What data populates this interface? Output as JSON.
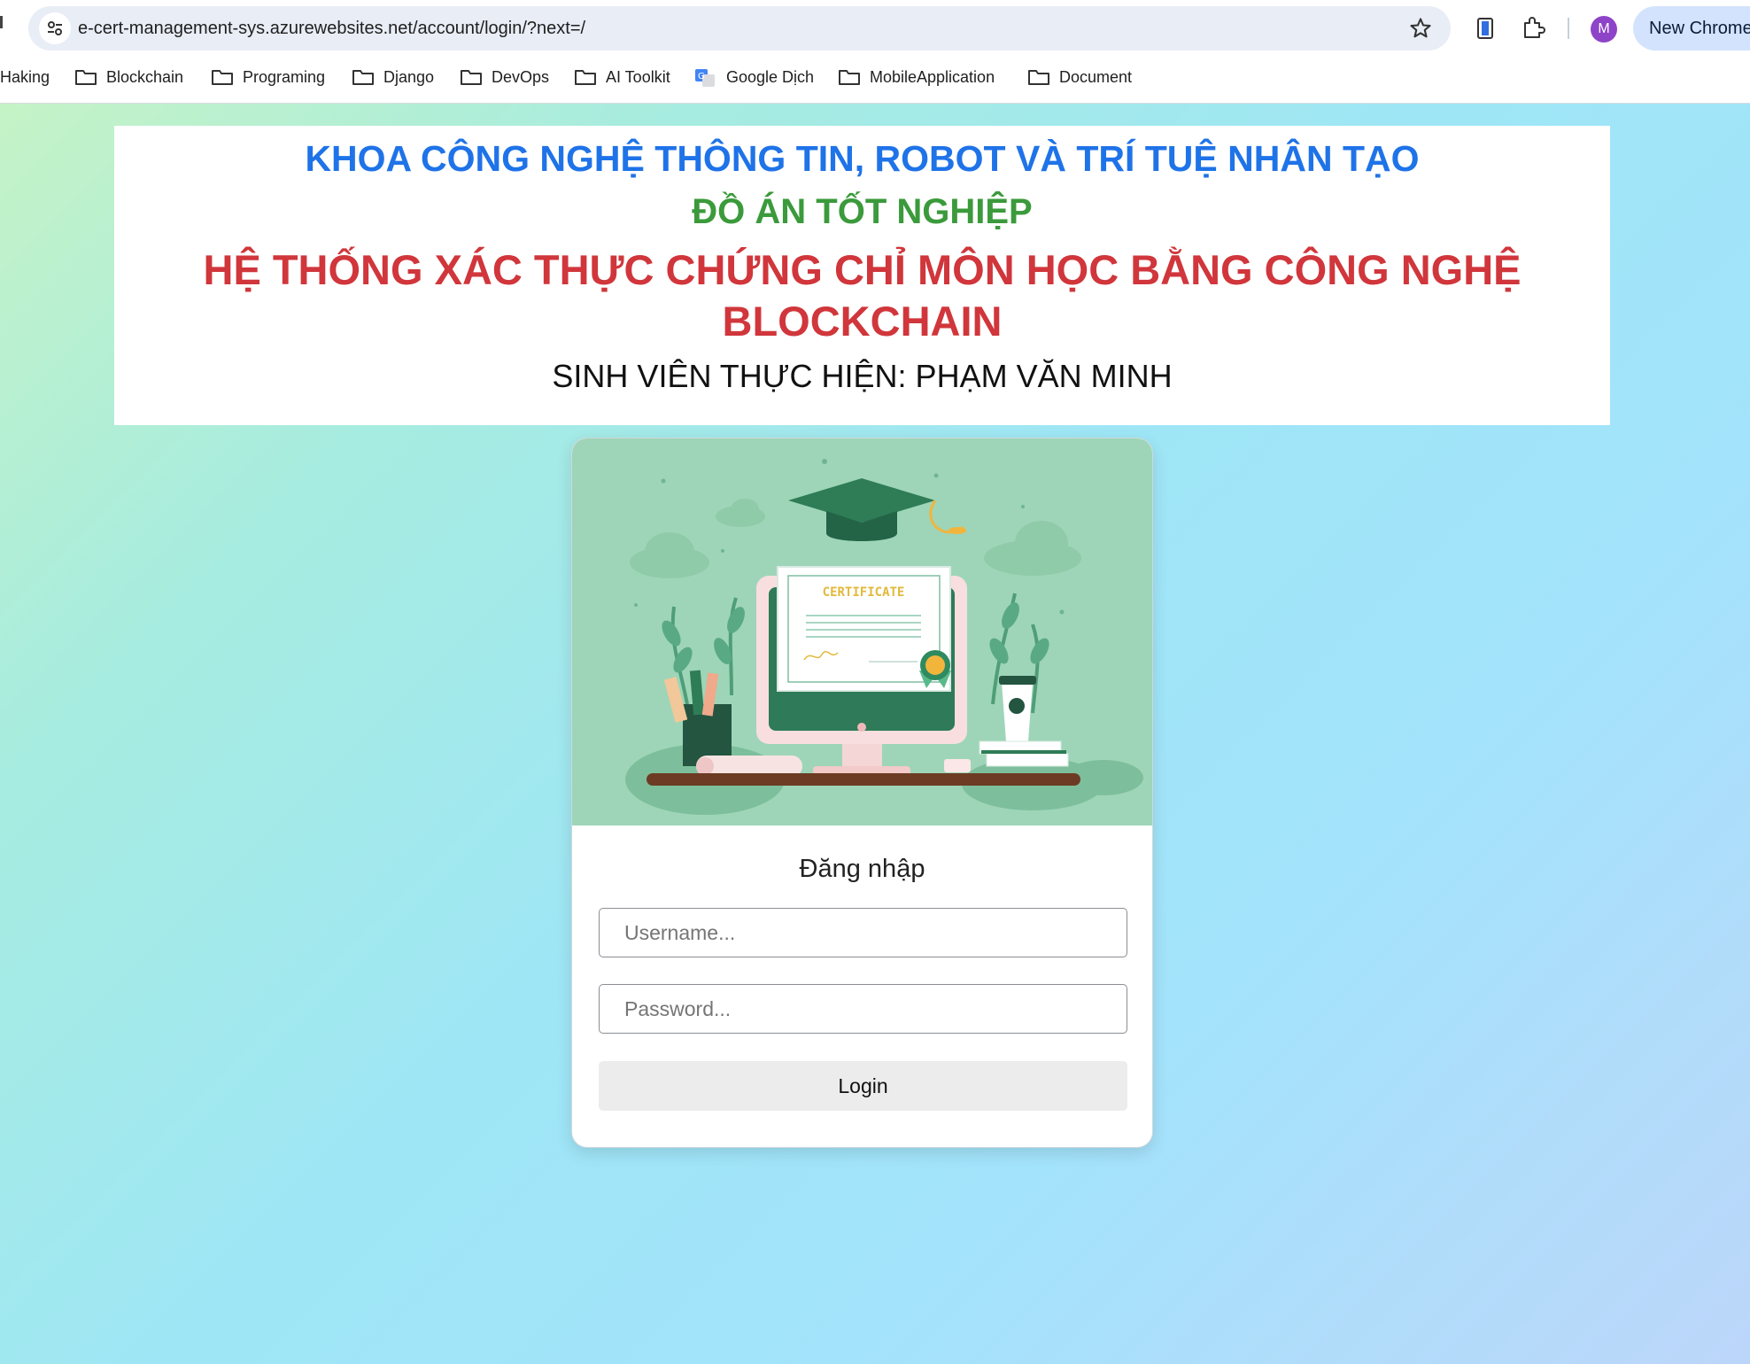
{
  "browser": {
    "url": "e-cert-management-sys.azurewebsites.net/account/login/?next=/",
    "profile_initial": "M",
    "new_chrome_label": "New Chrome",
    "bookmarks": [
      {
        "label": "Haking",
        "icon": "none"
      },
      {
        "label": "Blockchain",
        "icon": "folder-icon"
      },
      {
        "label": "Programing",
        "icon": "folder-icon"
      },
      {
        "label": "Django",
        "icon": "folder-icon"
      },
      {
        "label": "DevOps",
        "icon": "folder-icon"
      },
      {
        "label": "AI Toolkit",
        "icon": "folder-icon"
      },
      {
        "label": "Google Dịch",
        "icon": "google-translate-icon"
      },
      {
        "label": "MobileApplication",
        "icon": "folder-icon"
      },
      {
        "label": "Document",
        "icon": "folder-icon"
      }
    ]
  },
  "banner": {
    "faculty": "KHOA CÔNG NGHỆ THÔNG TIN, ROBOT VÀ TRÍ TUỆ NHÂN TẠO",
    "project_type": "ĐỒ ÁN TỐT NGHIỆP",
    "project_title": "HỆ THỐNG XÁC THỰC CHỨNG CHỈ MÔN HỌC BẰNG CÔNG NGHỆ BLOCKCHAIN",
    "student": "SINH VIÊN THỰC HIỆN: PHẠM VĂN MINH"
  },
  "login": {
    "title": "Đăng nhập",
    "username_placeholder": "Username...",
    "password_placeholder": "Password...",
    "button_label": "Login",
    "illustration_text": "CERTIFICATE"
  },
  "colors": {
    "faculty": "#1f73e8",
    "project_type": "#3b9a3b",
    "project_title": "#d0363b",
    "illustration_bg": "#9ed5b8"
  }
}
